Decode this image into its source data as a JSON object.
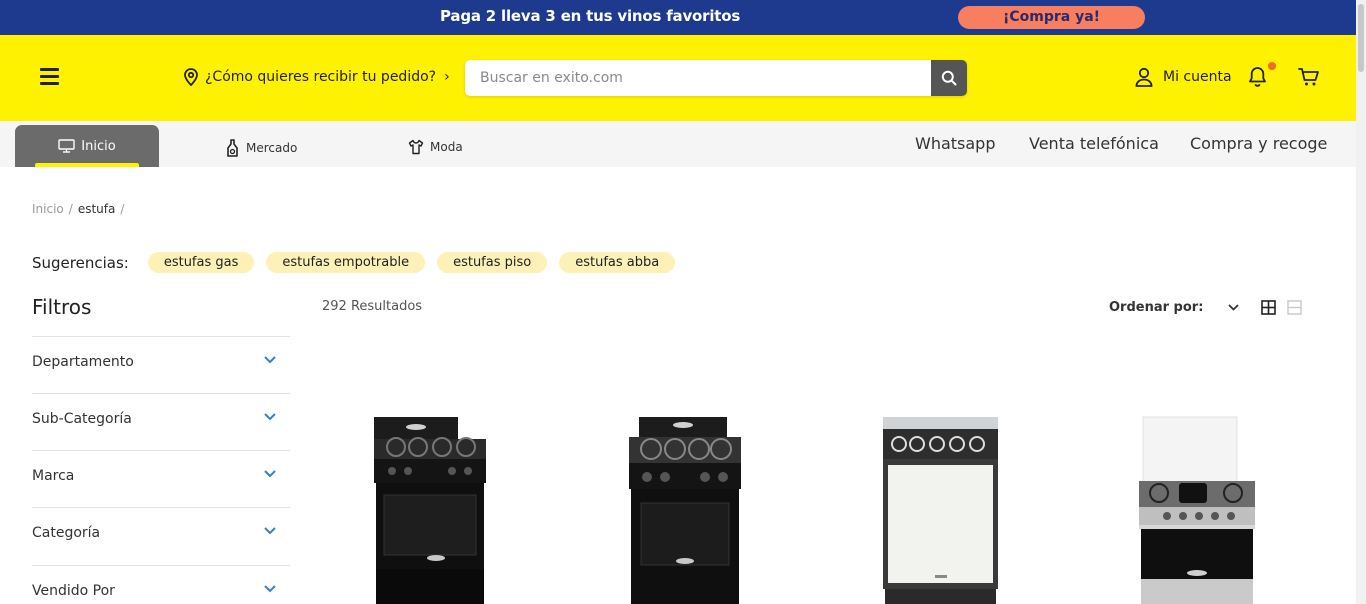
{
  "promo": {
    "text": "Paga 2 lleva 3 en tus vinos favoritos",
    "cta": "¡Compra ya!"
  },
  "header": {
    "delivery_text": "¿Cómo quieres recibir tu pedido?",
    "search_placeholder": "Buscar en exito.com",
    "account_label": "Mi cuenta"
  },
  "catnav": {
    "tabs": [
      {
        "label": "Inicio",
        "icon": "monitor-icon"
      },
      {
        "label": "Mercado",
        "icon": "bottle-icon"
      },
      {
        "label": "Moda",
        "icon": "shirt-icon"
      }
    ],
    "links": [
      "Whatsapp",
      "Venta telefónica",
      "Compra y recoge"
    ]
  },
  "breadcrumb": {
    "items": [
      "Inicio",
      "estufa"
    ]
  },
  "suggestions": {
    "label": "Sugerencias:",
    "chips": [
      "estufas gas",
      "estufas empotrable",
      "estufas piso",
      "estufas abba"
    ]
  },
  "filters": {
    "title": "Filtros",
    "items": [
      "Departamento",
      "Sub-Categoría",
      "Marca",
      "Categoría",
      "Vendido Por"
    ]
  },
  "results": {
    "count_text": "292 Resultados",
    "sort_label": "Ordenar por:"
  },
  "colors": {
    "promo_bg": "#1e3a8f",
    "header_bg": "#fff200",
    "promo_cta": "#f77f5f",
    "chip_bg": "#fdf1b8",
    "chevron": "#3b7fc4"
  }
}
